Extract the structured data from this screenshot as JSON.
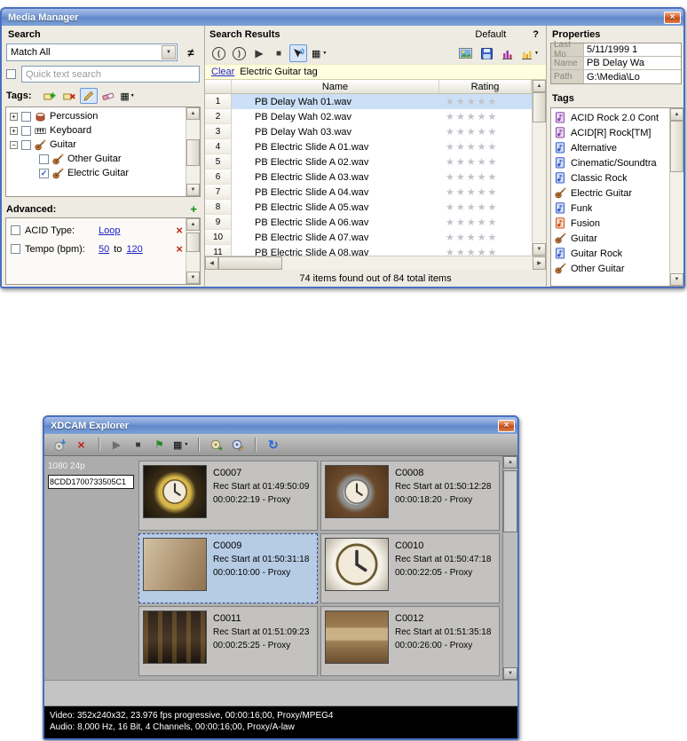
{
  "icons": {
    "close_x": "×",
    "dropdown_arrow": "▼",
    "arrow_up": "▲",
    "arrow_down": "▼",
    "arrow_left": "◀",
    "arrow_right": "▶",
    "plus": "+",
    "minus": "−",
    "check": "✓",
    "play": "▶",
    "stop": "■",
    "prev": "(",
    "next": ")",
    "view_grid": "▦",
    "flag": "⚑",
    "refresh": "↻",
    "stars": "★★★★★"
  },
  "media_manager": {
    "title": "Media Manager",
    "search": {
      "header": "Search",
      "match_dropdown": "Match All",
      "not_equal": "≠",
      "quick_search_placeholder": "Quick text search",
      "tags_label": "Tags:",
      "tree": [
        {
          "label": "Percussion",
          "icon": "drum",
          "expand": "plus",
          "checked": false,
          "indent": 0
        },
        {
          "label": "Keyboard",
          "icon": "keyboard",
          "expand": "plus",
          "checked": false,
          "indent": 0
        },
        {
          "label": "Guitar",
          "icon": "guitar",
          "expand": "minus",
          "checked": false,
          "indent": 0
        },
        {
          "label": "Other Guitar",
          "icon": "guitar",
          "expand": "",
          "checked": false,
          "indent": 1
        },
        {
          "label": "Electric Guitar",
          "icon": "guitar",
          "expand": "",
          "checked": true,
          "indent": 1
        }
      ],
      "advanced_label": "Advanced:",
      "filters": [
        {
          "label": "ACID Type:",
          "link1": "Loop"
        },
        {
          "label": "Tempo (bpm):",
          "link1": "50",
          "joiner": "to",
          "link2": "120"
        }
      ]
    },
    "results": {
      "header": "Search Results",
      "preset": "Default",
      "help_label": "?",
      "clear_link": "Clear",
      "filter_text": "Electric Guitar tag",
      "columns": [
        "Name",
        "Rating"
      ],
      "rows": [
        {
          "num": "1",
          "name": "PB Delay Wah 01.wav",
          "selected": true
        },
        {
          "num": "2",
          "name": "PB Delay Wah 02.wav"
        },
        {
          "num": "3",
          "name": "PB Delay Wah 03.wav"
        },
        {
          "num": "4",
          "name": "PB Electric Slide A 01.wav"
        },
        {
          "num": "5",
          "name": "PB Electric Slide A 02.wav"
        },
        {
          "num": "6",
          "name": "PB Electric Slide A 03.wav"
        },
        {
          "num": "7",
          "name": "PB Electric Slide A 04.wav"
        },
        {
          "num": "8",
          "name": "PB Electric Slide A 05.wav"
        },
        {
          "num": "9",
          "name": "PB Electric Slide A 06.wav"
        },
        {
          "num": "10",
          "name": "PB Electric Slide A 07.wav"
        },
        {
          "num": "11",
          "name": "PB Electric Slide A 08.wav"
        }
      ],
      "status": "74 items found out of 84 total items"
    },
    "properties": {
      "header": "Properties",
      "fields": [
        {
          "label": "Last Mo",
          "value": "5/11/1999 1"
        },
        {
          "label": "Name",
          "value": "PB Delay Wa"
        },
        {
          "label": "Path",
          "value": "G:\\Media\\Lo"
        }
      ],
      "tags_header": "Tags",
      "tags": [
        {
          "label": "ACID Rock 2.0 Cont",
          "icon": "note-purple"
        },
        {
          "label": "ACID[R] Rock[TM]",
          "icon": "note-purple"
        },
        {
          "label": "Alternative",
          "icon": "note-blue"
        },
        {
          "label": "Cinematic/Soundtra",
          "icon": "note-blue"
        },
        {
          "label": "Classic Rock",
          "icon": "note-blue"
        },
        {
          "label": "Electric Guitar",
          "icon": "guitar"
        },
        {
          "label": "Funk",
          "icon": "note-blue"
        },
        {
          "label": "Fusion",
          "icon": "note-red"
        },
        {
          "label": "Guitar",
          "icon": "guitar"
        },
        {
          "label": "Guitar Rock",
          "icon": "note-blue"
        },
        {
          "label": "Other Guitar",
          "icon": "guitar"
        }
      ]
    }
  },
  "xdcam": {
    "title": "XDCAM Explorer",
    "format": "1080 24p",
    "disc_id": "8CDD1700733505C1",
    "clips": [
      {
        "id": "C0007",
        "rec": "Rec Start at 01:49:50:09",
        "dur": "00:00:22:19 - Proxy"
      },
      {
        "id": "C0008",
        "rec": "Rec Start at 01:50:12:28",
        "dur": "00:00:18:20 - Proxy"
      },
      {
        "id": "C0009",
        "rec": "Rec Start at 01:50:31:18",
        "dur": "00:00:10:00 - Proxy",
        "selected": true
      },
      {
        "id": "C0010",
        "rec": "Rec Start at 01:50:47:18",
        "dur": "00:00:22:05 - Proxy"
      },
      {
        "id": "C0011",
        "rec": "Rec Start at 01:51:09:23",
        "dur": "00:00:25:25 - Proxy"
      },
      {
        "id": "C0012",
        "rec": "Rec Start at 01:51:35:18",
        "dur": "00:00:26:00 - Proxy"
      }
    ],
    "video_info": "Video: 352x240x32, 23.976 fps progressive, 00:00:16;00, Proxy/MPEG4",
    "audio_info": "Audio: 8,000 Hz, 16 Bit, 4 Channels, 00:00:16;00, Proxy/A-law"
  }
}
